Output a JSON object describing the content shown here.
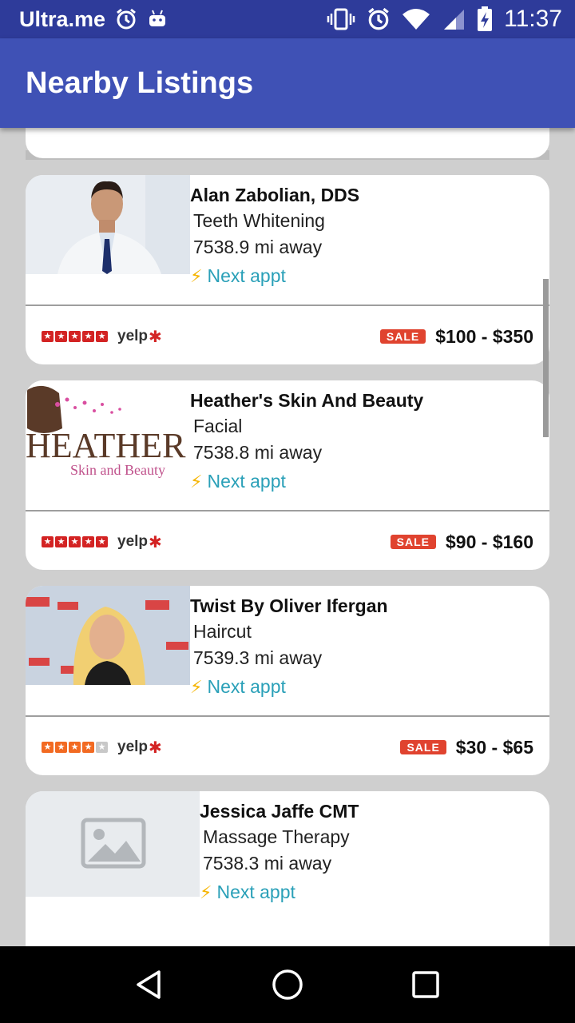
{
  "status_bar": {
    "carrier": "Ultra.me",
    "time": "11:37"
  },
  "app_bar": {
    "title": "Nearby Listings"
  },
  "listings": [
    {
      "name": "Alan Zabolian, DDS",
      "service": "Teeth Whitening",
      "distance": "7538.9 mi away",
      "next_appt": "Next appt",
      "rating": 5,
      "rating_source": "yelp",
      "sale_label": "SALE",
      "price": "$100 - $350",
      "thumbnail": "dentist-photo"
    },
    {
      "name": "Heather's Skin And Beauty",
      "service": "Facial",
      "distance": "7538.8 mi away",
      "next_appt": "Next appt",
      "rating": 5,
      "rating_source": "yelp",
      "sale_label": "SALE",
      "price": "$90 - $160",
      "thumbnail": "heather-logo",
      "logo_text": "HEATHER",
      "logo_subtext": "Skin and Beauty"
    },
    {
      "name": "Twist By Oliver Ifergan",
      "service": "Haircut",
      "distance": "7539.3 mi away",
      "next_appt": "Next appt",
      "rating": 4,
      "rating_source": "yelp",
      "sale_label": "SALE",
      "price": "$30 - $65",
      "thumbnail": "salon-photo"
    },
    {
      "name": "Jessica Jaffe CMT",
      "service": "Massage Therapy",
      "distance": "7538.3 mi away",
      "next_appt": "Next appt",
      "thumbnail": "image-placeholder-icon"
    }
  ],
  "colors": {
    "status_bar": "#2e3b9a",
    "app_bar": "#3f51b5",
    "accent_link": "#2aa0b8",
    "sale_badge": "#e0432f",
    "star_5": "#d32323",
    "star_4": "#f26a22"
  }
}
